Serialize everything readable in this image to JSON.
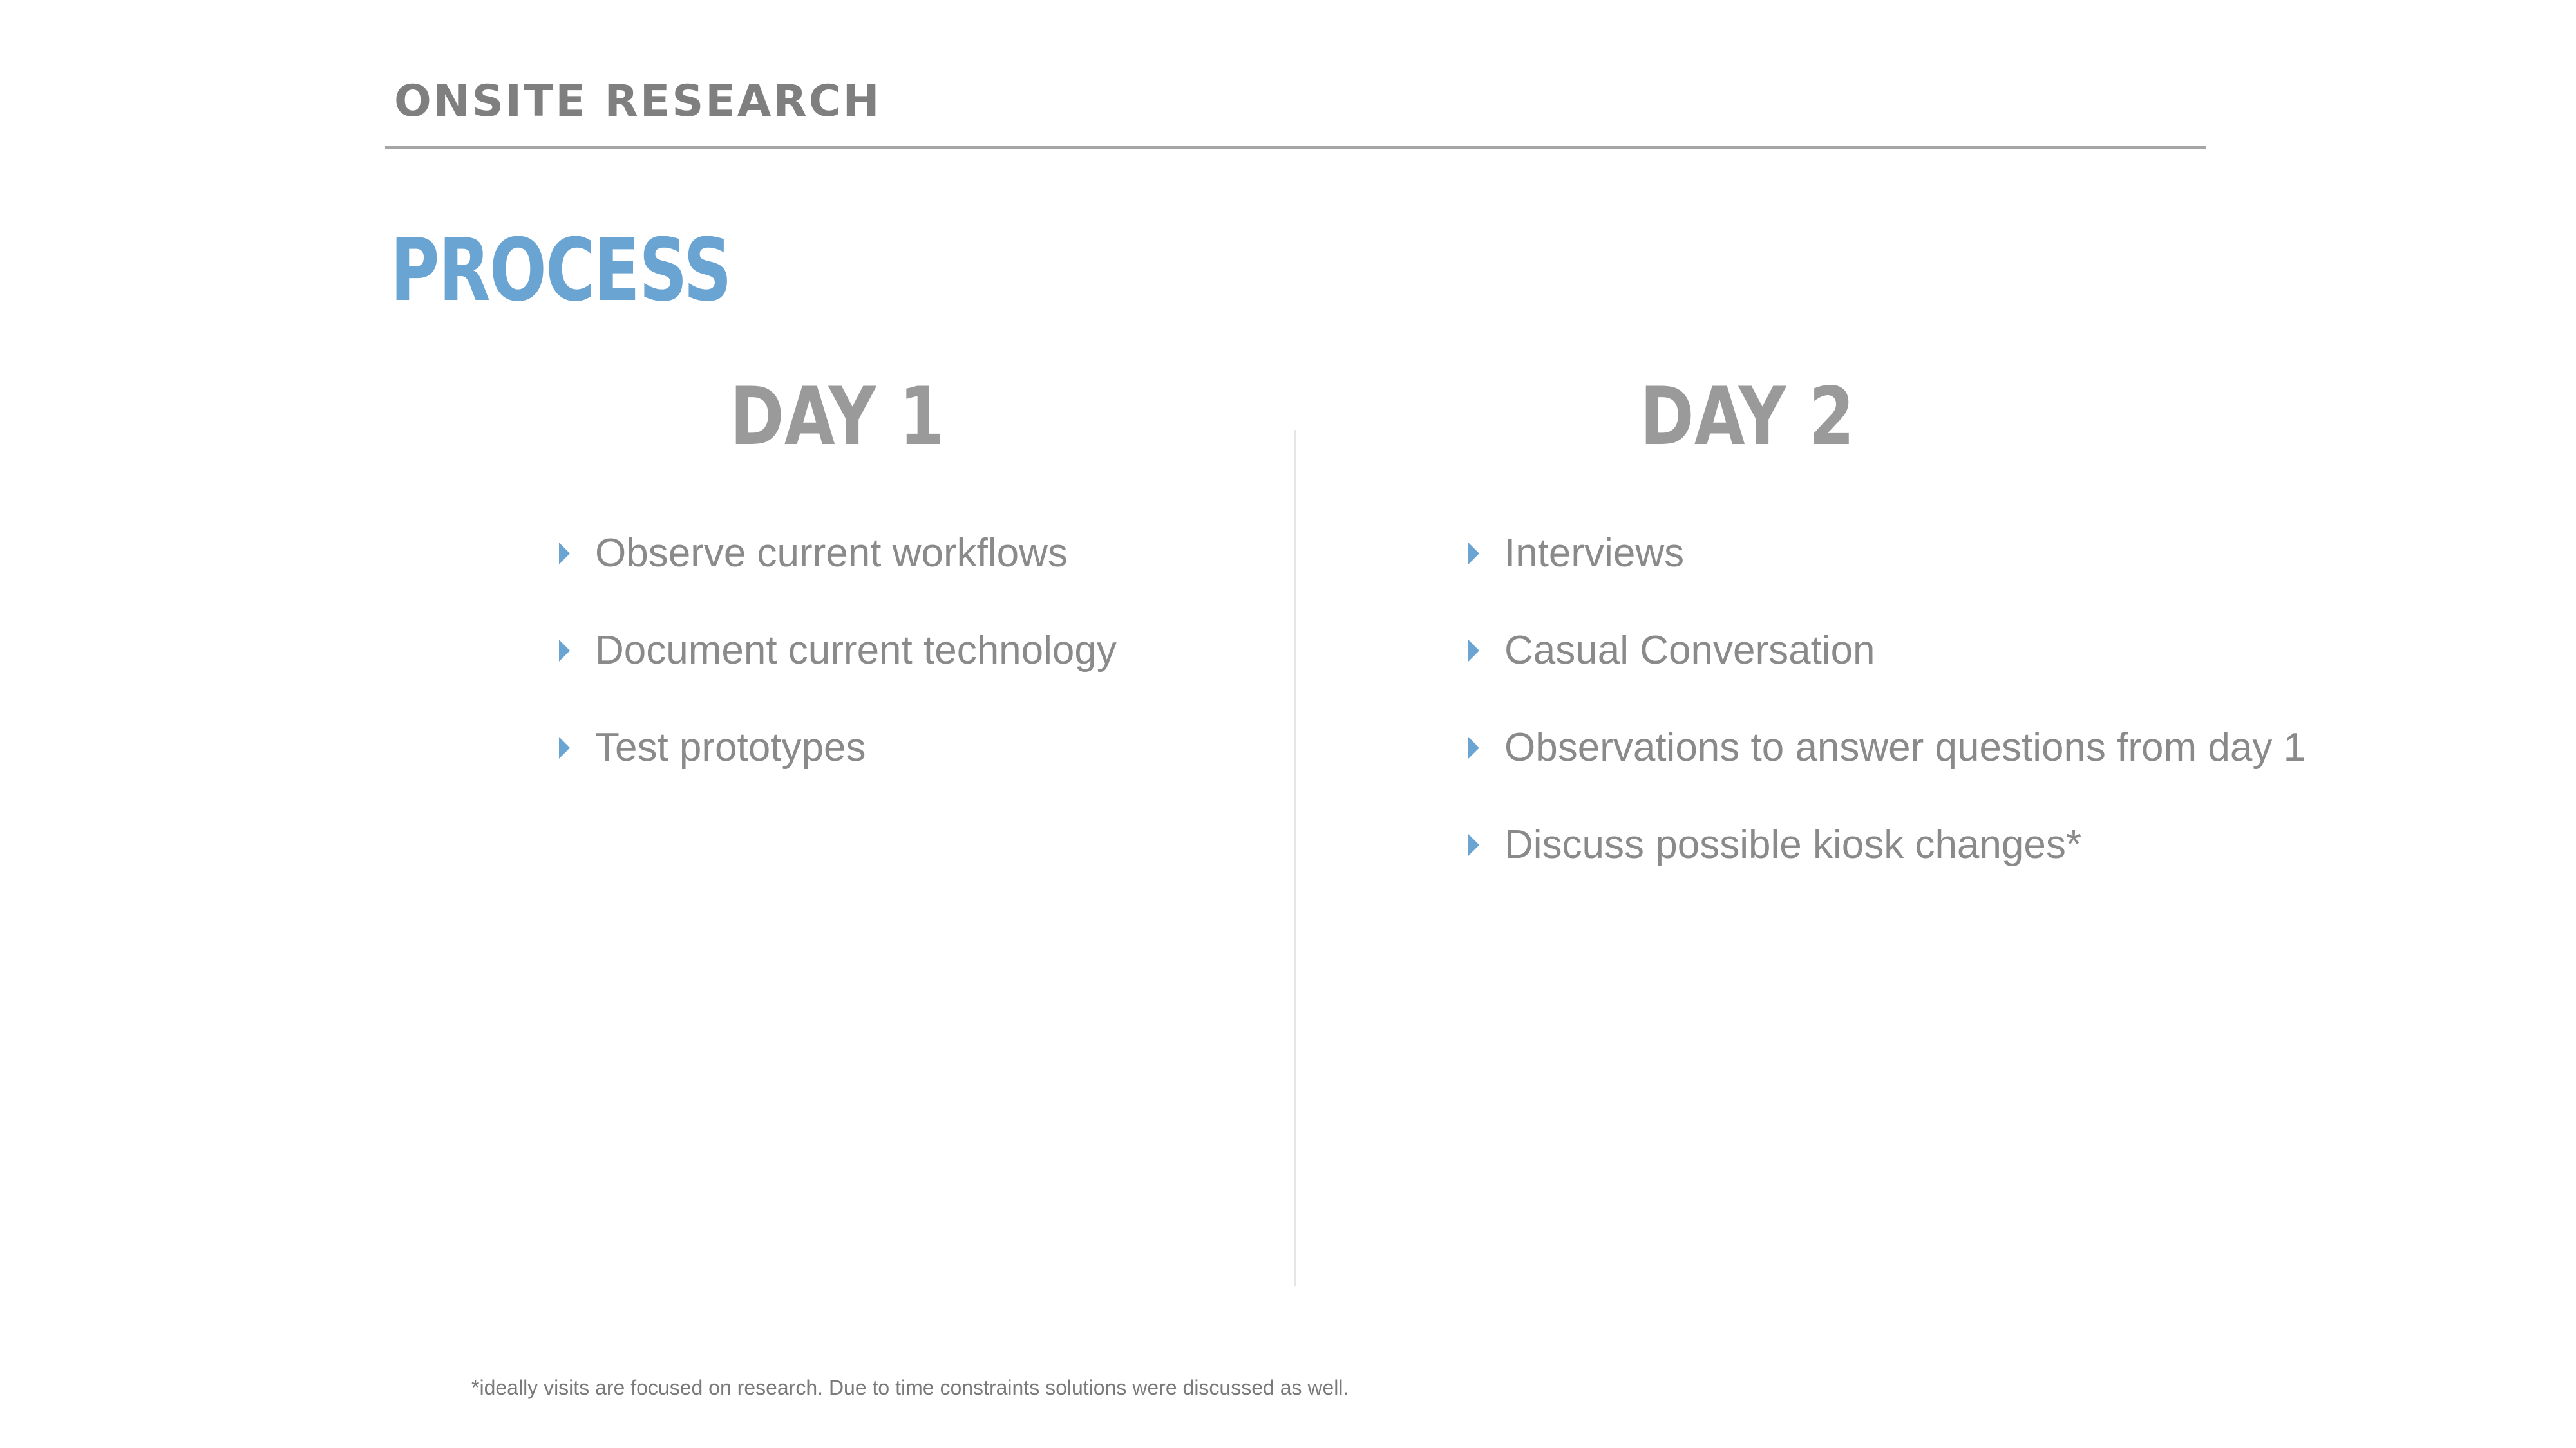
{
  "header": {
    "title": "ONSITE RESEARCH"
  },
  "section_title": "PROCESS",
  "day1": {
    "heading": "DAY 1",
    "items": [
      "Observe current workflows",
      "Document current technology",
      "Test prototypes"
    ]
  },
  "day2": {
    "heading": "DAY 2",
    "items": [
      "Interviews",
      "Casual Conversation",
      "Observations to answer questions from day 1",
      "Discuss possible kiosk changes*"
    ]
  },
  "footnote": "*ideally visits are focused on research. Due to time constraints solutions were discussed as well.",
  "colors": {
    "accent": "#6aa4d3",
    "text_gray": "#8a8a8a",
    "heading_gray": "#9a9a9a",
    "rule": "#a6a6a6"
  },
  "icons": {
    "bullet": "caret-right-icon"
  }
}
